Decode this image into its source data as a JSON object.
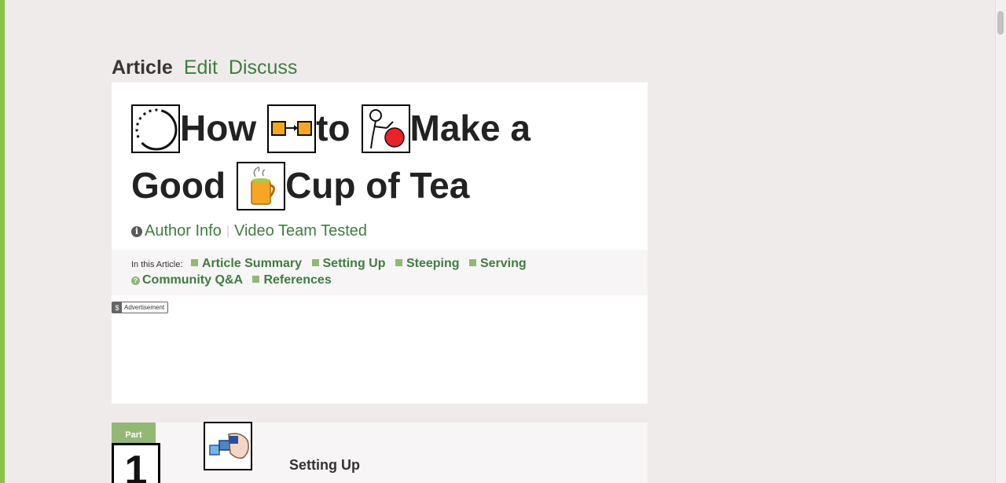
{
  "tabs": [
    {
      "label": "Article"
    },
    {
      "label": "Edit"
    },
    {
      "label": "Discuss"
    }
  ],
  "article": {
    "title_words": [
      "How",
      "to",
      "Make a",
      "Good",
      "Cup of Tea"
    ],
    "symbols": [
      "circle-symbol-icon",
      "boxes-arrow-symbol-icon",
      "person-making-symbol-icon",
      "tea-mug-symbol-icon"
    ],
    "meta": {
      "author_info": "Author Info",
      "tested": "Video Team Tested"
    },
    "toc": {
      "label": "In this Article:",
      "items": [
        "Article Summary",
        "Setting Up",
        "Steeping",
        "Serving",
        "Community Q&A",
        "References"
      ]
    },
    "ad_label": "Advertisement"
  },
  "part": {
    "tab_label": "Part",
    "number": "1",
    "title": "Setting Up"
  },
  "colors": {
    "link_green": "#3f7d3f",
    "bullet_green": "#93b874",
    "page_bg": "#efebeb"
  }
}
